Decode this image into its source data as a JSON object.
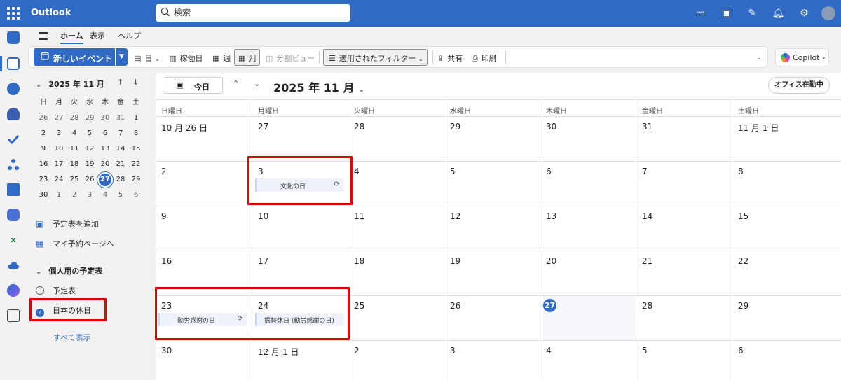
{
  "app": {
    "name": "Outlook"
  },
  "search": {
    "placeholder": "検索"
  },
  "ribbon": {
    "tabs": [
      "ホーム",
      "表示",
      "ヘルプ"
    ],
    "new_event": "新しいイベント",
    "day": "日",
    "work_week": "稼働日",
    "week": "週",
    "month": "月",
    "split_view": "分割ビュー",
    "filter": "適用されたフィルター",
    "share": "共有",
    "print": "印刷",
    "copilot": "Copilot"
  },
  "mini_calendar": {
    "title": "2025 年 11 月",
    "weekdays": [
      "日",
      "月",
      "火",
      "水",
      "木",
      "金",
      "土"
    ],
    "weeks": [
      [
        "26",
        "27",
        "28",
        "29",
        "30",
        "31",
        "1"
      ],
      [
        "2",
        "3",
        "4",
        "5",
        "6",
        "7",
        "8"
      ],
      [
        "9",
        "10",
        "11",
        "12",
        "13",
        "14",
        "15"
      ],
      [
        "16",
        "17",
        "18",
        "19",
        "20",
        "21",
        "22"
      ],
      [
        "23",
        "24",
        "25",
        "26",
        "27",
        "28",
        "29"
      ],
      [
        "30",
        "1",
        "2",
        "3",
        "4",
        "5",
        "6"
      ]
    ],
    "today": "27"
  },
  "left_pane": {
    "add_calendar": "予定表を追加",
    "booking_page": "マイ予約ページへ",
    "group_title": "個人用の予定表",
    "calendars": [
      "予定表",
      "日本の休日"
    ],
    "show_all": "すべて表示"
  },
  "calendar": {
    "today_button": "今日",
    "month_title": "2025 年 11 月",
    "office_status": "オフィス在勤中",
    "weekday_headers": [
      "日曜日",
      "月曜日",
      "火曜日",
      "水曜日",
      "木曜日",
      "金曜日",
      "土曜日"
    ],
    "weeks": [
      [
        "10 月 26 日",
        "27",
        "28",
        "29",
        "30",
        "31",
        "11 月 1 日"
      ],
      [
        "2",
        "3",
        "4",
        "5",
        "6",
        "7",
        "8"
      ],
      [
        "9",
        "10",
        "11",
        "12",
        "13",
        "14",
        "15"
      ],
      [
        "16",
        "17",
        "18",
        "19",
        "20",
        "21",
        "22"
      ],
      [
        "23",
        "24",
        "25",
        "26",
        "27",
        "28",
        "29"
      ],
      [
        "30",
        "12 月 1 日",
        "2",
        "3",
        "4",
        "5",
        "6"
      ]
    ],
    "events": {
      "culture_day": "文化の日",
      "labor_thanksgiving": "勤労感謝の日",
      "substitute_holiday": "振替休日 (勤労感謝の日)"
    }
  },
  "colors": {
    "brand": "#2f6ac5",
    "highlight": "#e00000"
  }
}
